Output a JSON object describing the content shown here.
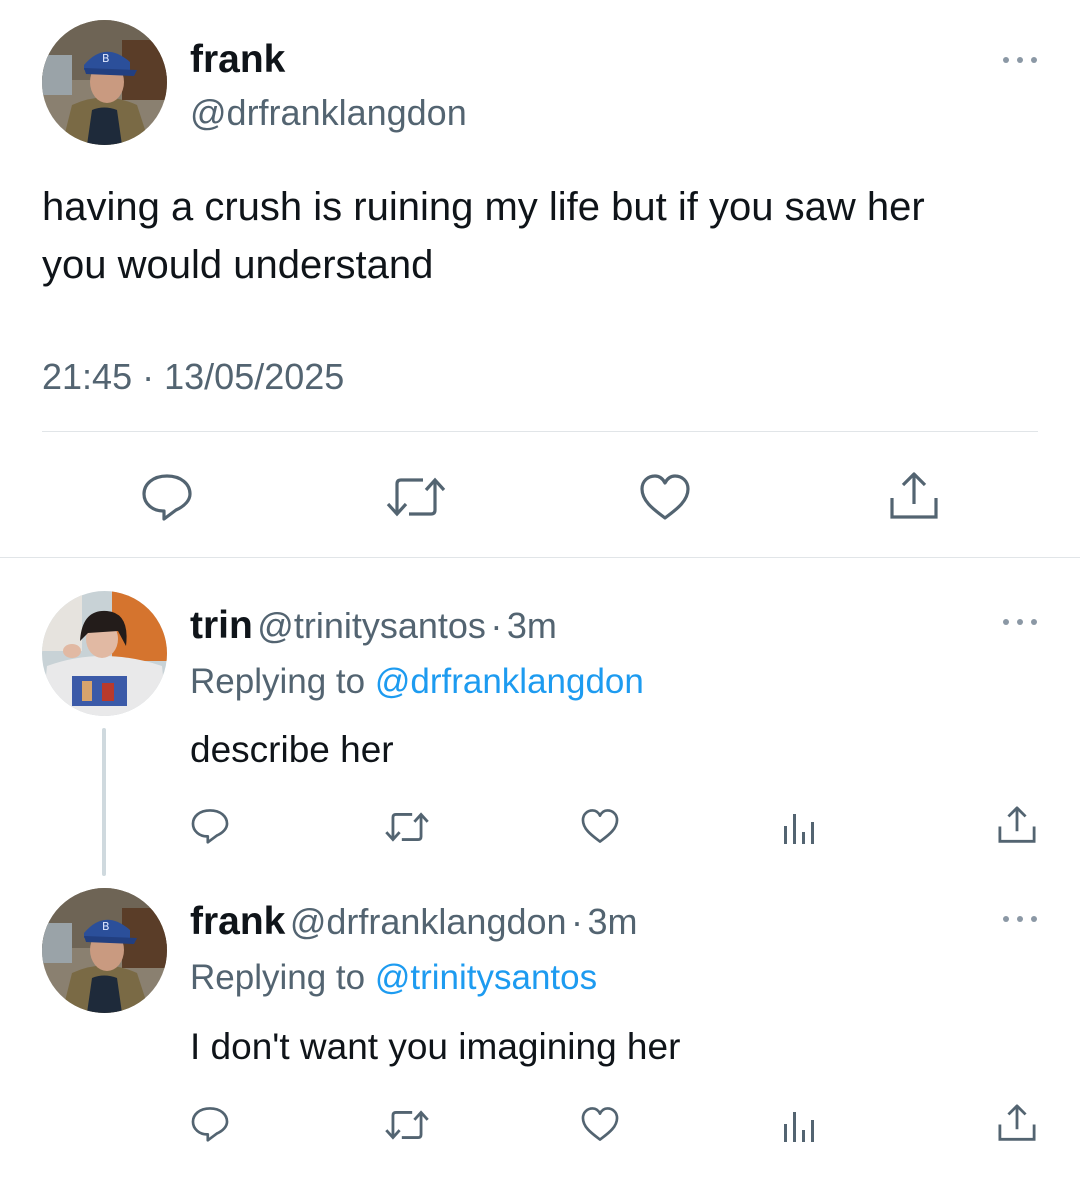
{
  "main_tweet": {
    "name": "frank",
    "handle": "@drfranklangdon",
    "text": "having a crush is ruining my life but if you saw her you would understand",
    "time": "21:45",
    "separator": "·",
    "date": "13/05/2025",
    "actions": [
      "reply-icon",
      "retweet-icon",
      "like-icon",
      "share-icon"
    ]
  },
  "replies": [
    {
      "name": "trin",
      "handle": "@trinitysantos",
      "sep": "·",
      "age": "3m",
      "replying_prefix": "Replying to ",
      "replying_to": "@drfranklangdon",
      "text": "describe her",
      "actions": [
        "reply-icon",
        "retweet-icon",
        "like-icon",
        "views-icon",
        "share-icon"
      ]
    },
    {
      "name": "frank",
      "handle": "@drfranklangdon",
      "sep": "·",
      "age": "3m",
      "replying_prefix": "Replying to ",
      "replying_to": "@trinitysantos",
      "text": "I don't want you imagining her",
      "actions": [
        "reply-icon",
        "retweet-icon",
        "like-icon",
        "views-icon",
        "share-icon"
      ]
    }
  ],
  "colors": {
    "text": "#0f1419",
    "secondary": "#536471",
    "link": "#1d9bf0",
    "divider": "#e1e5e8"
  }
}
